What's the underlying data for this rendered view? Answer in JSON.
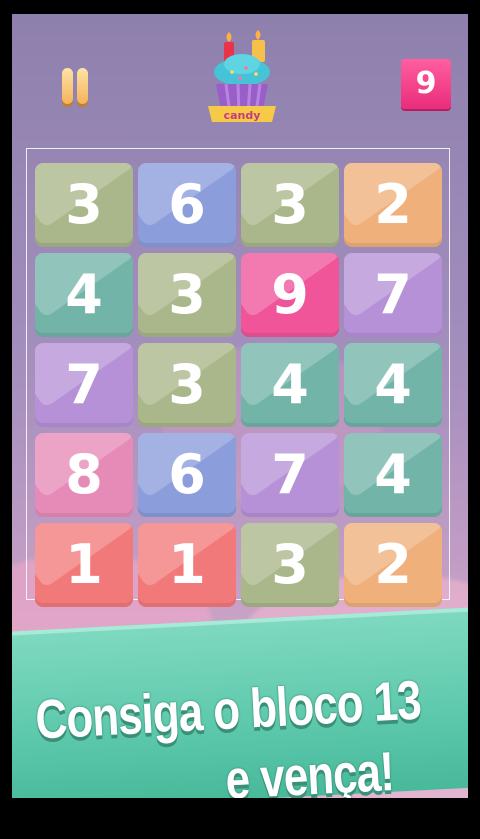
{
  "header": {
    "pause_icon": "pause-icon",
    "logo_text": "candy",
    "max_tile": "9",
    "colors": {
      "pause": "#f3b35a",
      "badge": "#ff4d94"
    }
  },
  "board": {
    "rows": [
      [
        {
          "value": "3",
          "color": "#a9b78a"
        },
        {
          "value": "6",
          "color": "#8b9ddb"
        },
        {
          "value": "3",
          "color": "#a9b78a"
        },
        {
          "value": "2",
          "color": "#f0b07b"
        }
      ],
      [
        {
          "value": "4",
          "color": "#72b4a8"
        },
        {
          "value": "3",
          "color": "#a9b78a"
        },
        {
          "value": "9",
          "color": "#f0559a"
        },
        {
          "value": "7",
          "color": "#b691d7"
        }
      ],
      [
        {
          "value": "7",
          "color": "#b691d7"
        },
        {
          "value": "3",
          "color": "#a9b78a"
        },
        {
          "value": "4",
          "color": "#72b4a8"
        },
        {
          "value": "4",
          "color": "#72b4a8"
        }
      ],
      [
        {
          "value": "8",
          "color": "#e68bb7"
        },
        {
          "value": "6",
          "color": "#8b9ddb"
        },
        {
          "value": "7",
          "color": "#b691d7"
        },
        {
          "value": "4",
          "color": "#72b4a8"
        }
      ],
      [
        {
          "value": "1",
          "color": "#f2797a"
        },
        {
          "value": "1",
          "color": "#f2797a"
        },
        {
          "value": "3",
          "color": "#a9b78a"
        },
        {
          "value": "2",
          "color": "#f0b07b"
        }
      ]
    ]
  },
  "banner": {
    "line1": "Consiga o bloco 13",
    "line2": "e vença!",
    "color": "#5cc8ab"
  }
}
